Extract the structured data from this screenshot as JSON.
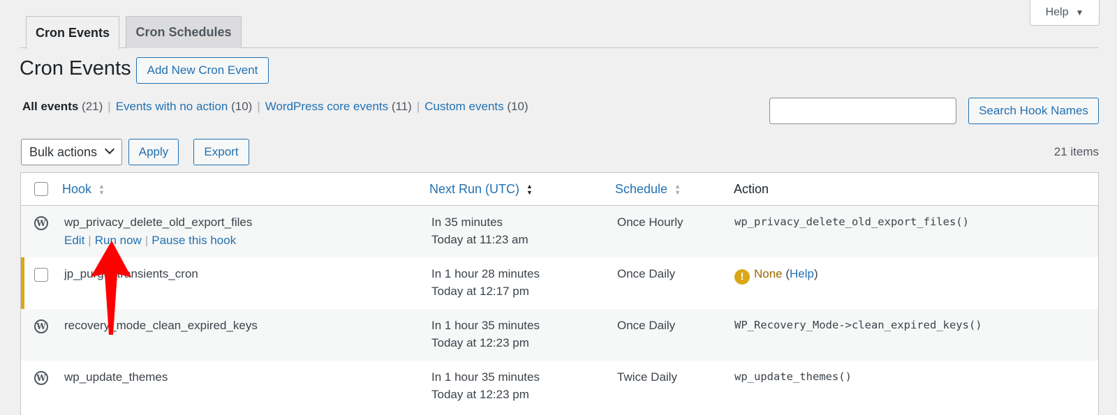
{
  "help_tab": {
    "label": "Help"
  },
  "tabs": [
    {
      "label": "Cron Events",
      "active": true
    },
    {
      "label": "Cron Schedules",
      "active": false
    }
  ],
  "page": {
    "title": "Cron Events",
    "add_button": "Add New Cron Event"
  },
  "filters": [
    {
      "label": "All events",
      "count": "(21)",
      "current": true
    },
    {
      "label": "Events with no action",
      "count": "(10)",
      "current": false
    },
    {
      "label": "WordPress core events",
      "count": "(11)",
      "current": false
    },
    {
      "label": "Custom events",
      "count": "(10)",
      "current": false
    }
  ],
  "search": {
    "value": "",
    "button": "Search Hook Names"
  },
  "bulk": {
    "selected": "Bulk actions",
    "apply": "Apply",
    "export": "Export"
  },
  "items_count": "21 items",
  "table": {
    "columns": {
      "hook": "Hook",
      "next_run": "Next Run (UTC)",
      "schedule": "Schedule",
      "action": "Action"
    },
    "row_actions": {
      "edit": "Edit",
      "run_now": "Run now",
      "pause": "Pause this hook"
    },
    "rows": [
      {
        "hook": "wp_privacy_delete_old_export_files",
        "next_run": "In 35 minutes",
        "next_run_time": "Today at 11:23 am",
        "schedule": "Once Hourly",
        "action": "wp_privacy_delete_old_export_files()",
        "core": true
      },
      {
        "hook": "jp_purge_transients_cron",
        "next_run": "In 1 hour 28 minutes",
        "next_run_time": "Today at 12:17 pm",
        "schedule": "Once Daily",
        "action_none": "None",
        "action_help": "Help",
        "core": false
      },
      {
        "hook": "recovery_mode_clean_expired_keys",
        "next_run": "In 1 hour 35 minutes",
        "next_run_time": "Today at 12:23 pm",
        "schedule": "Once Daily",
        "action": "WP_Recovery_Mode->clean_expired_keys()",
        "core": true
      },
      {
        "hook": "wp_update_themes",
        "next_run": "In 1 hour 35 minutes",
        "next_run_time": "Today at 12:23 pm",
        "schedule": "Twice Daily",
        "action": "wp_update_themes()",
        "core": true
      }
    ]
  },
  "colors": {
    "link": "#2271b1",
    "warning": "#dba617",
    "arrow": "#ff0000"
  }
}
